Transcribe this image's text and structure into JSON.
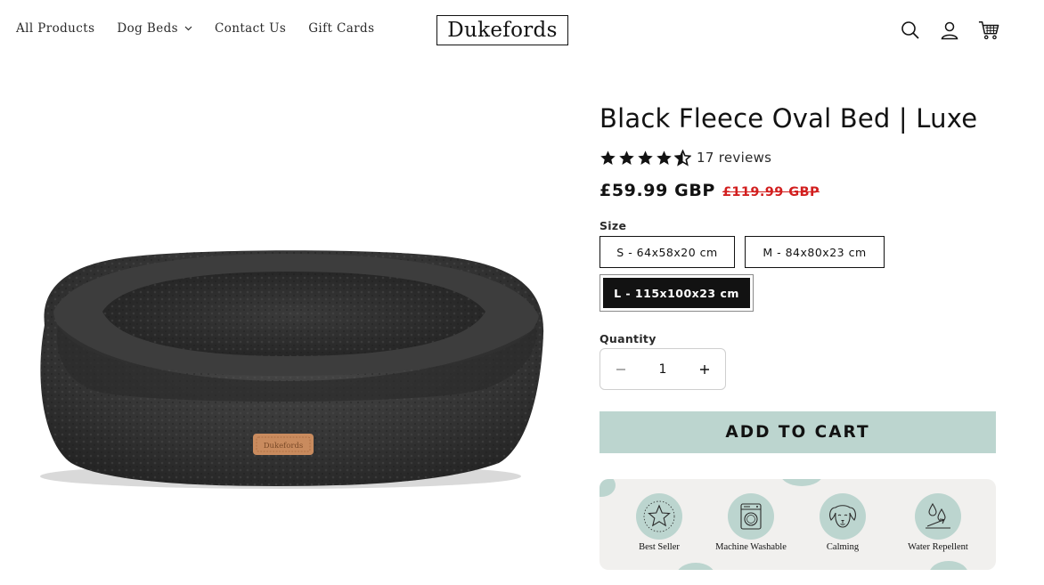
{
  "nav": {
    "items": [
      {
        "label": "All Products"
      },
      {
        "label": "Dog Beds",
        "has_dropdown": true
      },
      {
        "label": "Contact Us"
      },
      {
        "label": "Gift Cards"
      }
    ]
  },
  "brand": {
    "logo_text": "Dukefords"
  },
  "header_icons": [
    "search-icon",
    "account-icon",
    "cart-icon"
  ],
  "product": {
    "title": "Black Fleece Oval Bed | Luxe",
    "rating": {
      "stars": 4.5,
      "max": 5,
      "reviews_label": "17 reviews"
    },
    "price": "£59.99 GBP",
    "compare_at_price": "£119.99 GBP",
    "image_label": "Dukefords",
    "size": {
      "label": "Size",
      "options": [
        {
          "label": "S - 64x58x20 cm",
          "selected": false
        },
        {
          "label": "M - 84x80x23 cm",
          "selected": false
        },
        {
          "label": "L - 115x100x23 cm",
          "selected": true
        }
      ]
    },
    "quantity": {
      "label": "Quantity",
      "value": "1"
    },
    "add_to_cart_label": "ADD TO CART",
    "badges": [
      {
        "label": "Best Seller",
        "icon": "star-icon"
      },
      {
        "label": "Machine Washable",
        "icon": "washing-machine-icon"
      },
      {
        "label": "Calming",
        "icon": "dog-icon"
      },
      {
        "label": "Water Repellent",
        "icon": "water-drops-icon"
      }
    ]
  },
  "colors": {
    "accent": "#bcd5cf",
    "text": "#121212",
    "sale_red": "#d21f1f",
    "badge_panel": "#f1f0ee"
  }
}
